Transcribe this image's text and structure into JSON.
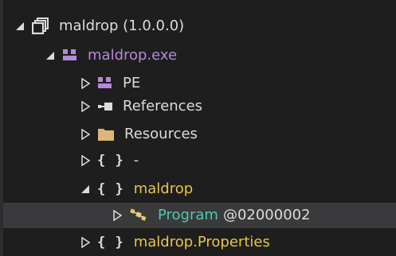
{
  "tree": {
    "root": {
      "label": "maldrop (1.0.0.0)",
      "color": "#dcdcdc",
      "icon": "assembly-icon"
    },
    "module": {
      "label": "maldrop.exe",
      "color": "#b48ad8",
      "icon": "module-icon"
    },
    "items": [
      {
        "label": "PE",
        "color": "#dcdcdc",
        "icon": "pe-icon"
      },
      {
        "label": "References",
        "color": "#dcdcdc",
        "icon": "references-icon"
      },
      {
        "label": "Resources",
        "color": "#dcdcdc",
        "icon": "folder-icon"
      },
      {
        "label": "-",
        "color": "#dcdcdc",
        "icon": "namespace-icon",
        "braces": "{ }"
      },
      {
        "label": "maldrop",
        "color": "#e8c547",
        "icon": "namespace-icon",
        "braces": "{ }"
      },
      {
        "label": "Program",
        "token": "@02000002",
        "color": "#4ec9b0",
        "icon": "class-icon"
      },
      {
        "label": "maldrop.Properties",
        "color": "#e8c547",
        "icon": "namespace-icon",
        "braces": "{ }"
      }
    ]
  },
  "colors": {
    "background": "#1e1e1e",
    "selection": "#3a3a3d",
    "namespace": "#e8c547",
    "module": "#b48ad8",
    "class": "#4ec9b0",
    "text": "#dcdcdc"
  }
}
